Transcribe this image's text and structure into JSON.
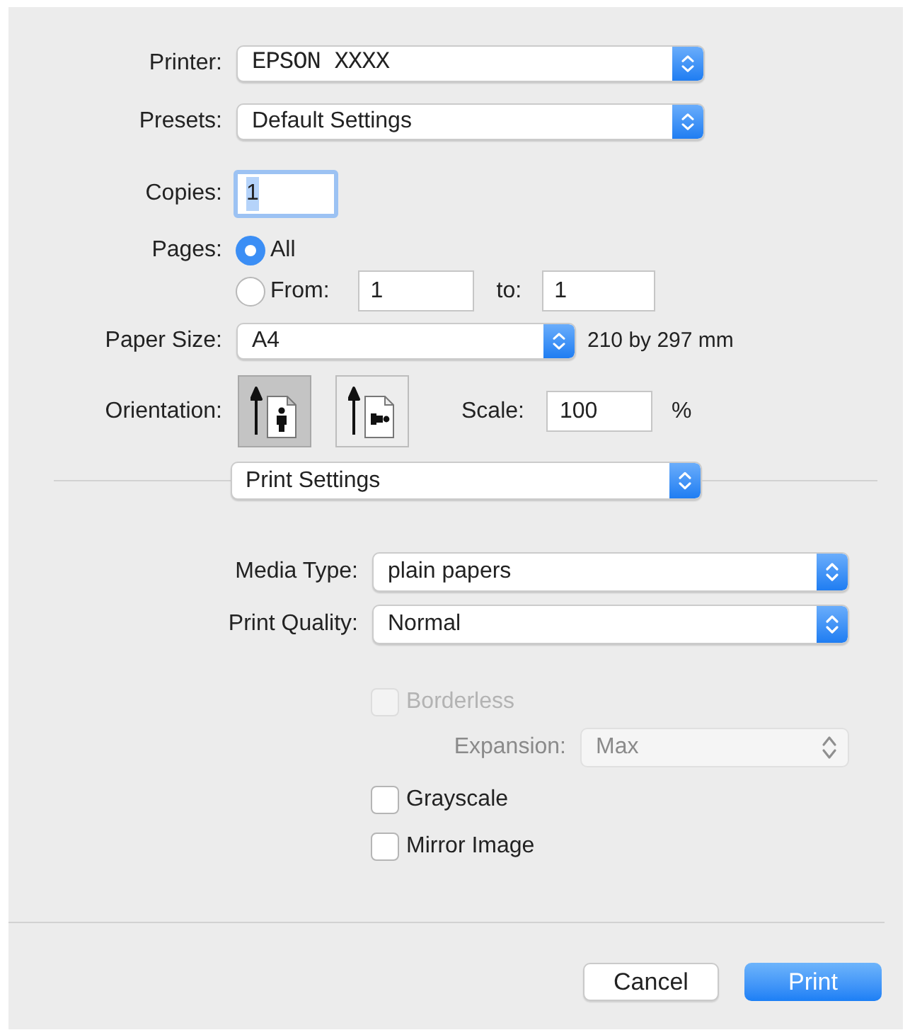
{
  "printer": {
    "label": "Printer:",
    "value": "EPSON XXXX"
  },
  "presets": {
    "label": "Presets:",
    "value": "Default Settings"
  },
  "copies": {
    "label": "Copies:",
    "value": "1",
    "focused": true
  },
  "pages": {
    "label": "Pages:",
    "options": [
      {
        "label": "All",
        "selected": true
      },
      {
        "label": "From:",
        "selected": false
      }
    ],
    "from": "1",
    "to_label": "to:",
    "to": "1"
  },
  "paper_size": {
    "label": "Paper Size:",
    "value": "A4",
    "dimensions": "210 by 297 mm"
  },
  "orientation": {
    "label": "Orientation:",
    "options": [
      {
        "kind": "portrait",
        "selected": true
      },
      {
        "kind": "landscape",
        "selected": false
      }
    ]
  },
  "scale": {
    "label": "Scale:",
    "value": "100",
    "unit": "%"
  },
  "section_menu": {
    "value": "Print Settings"
  },
  "settings": [
    {
      "label": "Media Type:",
      "value": "plain papers"
    },
    {
      "label": "Print Quality:",
      "value": "Normal"
    }
  ],
  "options": [
    {
      "kind": "checkbox",
      "label": "Borderless",
      "checked": false,
      "disabled": true
    },
    {
      "kind": "select",
      "label": "Expansion:",
      "value": "Max",
      "disabled": true
    },
    {
      "kind": "checkbox",
      "label": "Grayscale",
      "checked": false,
      "disabled": false
    },
    {
      "kind": "checkbox",
      "label": "Mirror Image",
      "checked": false,
      "disabled": false
    }
  ],
  "buttons": [
    {
      "label": "Cancel",
      "kind": "secondary"
    },
    {
      "label": "Print",
      "kind": "primary"
    }
  ]
}
